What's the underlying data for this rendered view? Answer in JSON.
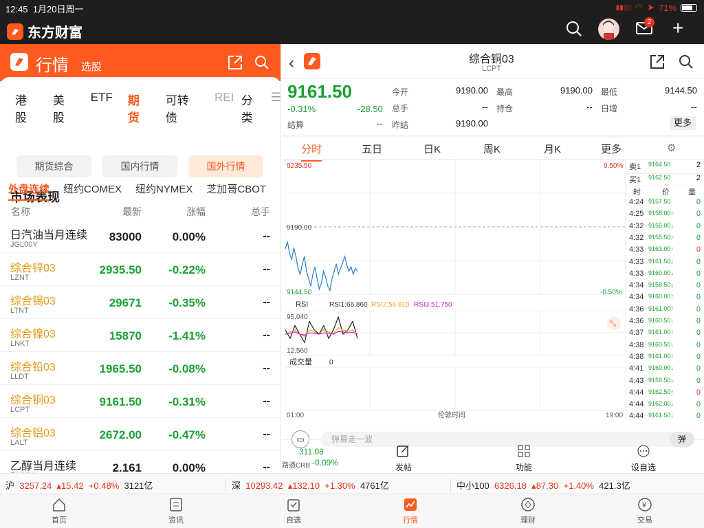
{
  "status": {
    "time": "12:45",
    "date": "1月20日周一",
    "battery": "71%"
  },
  "app": {
    "name": "东方财富",
    "badge": "2"
  },
  "left": {
    "title": "行情",
    "subtitle": "选股",
    "tabs": [
      "港股",
      "美股",
      "ETF",
      "期货",
      "可转债",
      "REI",
      "分类"
    ],
    "pills": [
      "期货综合",
      "国内行情",
      "国外行情"
    ],
    "section": "市场表现",
    "subtabs": [
      "外盘连续",
      "纽约COMEX",
      "纽约NYMEX",
      "芝加哥CBOT"
    ],
    "cols": {
      "name": "名称",
      "price": "最新",
      "change": "涨幅",
      "vol": "总手"
    },
    "rows": [
      {
        "name": "日汽油当月连续",
        "code": "JGL00Y",
        "price": "83000",
        "change": "0.00%",
        "vol": "--",
        "nc": "k",
        "pc": "k"
      },
      {
        "name": "综合锌03",
        "code": "LZNT",
        "price": "2935.50",
        "change": "-0.22%",
        "vol": "--",
        "nc": "o",
        "pc": "g"
      },
      {
        "name": "综合锡03",
        "code": "LTNT",
        "price": "29671",
        "change": "-0.35%",
        "vol": "--",
        "nc": "o",
        "pc": "g"
      },
      {
        "name": "综合镍03",
        "code": "LNKT",
        "price": "15870",
        "change": "-1.41%",
        "vol": "--",
        "nc": "o",
        "pc": "g"
      },
      {
        "name": "综合铅03",
        "code": "LLDT",
        "price": "1965.50",
        "change": "-0.08%",
        "vol": "--",
        "nc": "o",
        "pc": "g"
      },
      {
        "name": "综合铜03",
        "code": "LCPT",
        "price": "9161.50",
        "change": "-0.31%",
        "vol": "--",
        "nc": "o",
        "pc": "g"
      },
      {
        "name": "综合铝03",
        "code": "LALT",
        "price": "2672.00",
        "change": "-0.47%",
        "vol": "--",
        "nc": "o",
        "pc": "g"
      },
      {
        "name": "乙醇当月连续",
        "code": "EH00Y",
        "price": "2.161",
        "change": "0.00%",
        "vol": "--",
        "nc": "k",
        "pc": "k"
      }
    ]
  },
  "quote": {
    "title": "综合铜03",
    "code": "LCPT",
    "price": "9161.50",
    "pct": "-0.31%",
    "chg": "-28.50",
    "open_label": "今开",
    "open": "9190.00",
    "high_label": "最高",
    "high": "9190.00",
    "low_label": "最低",
    "low": "9144.50",
    "vol_label": "总手",
    "vol": "--",
    "oi_label": "持仓",
    "oi": "--",
    "daily_label": "日增",
    "daily": "--",
    "settle_label": "结算",
    "settle": "--",
    "prev_label": "昨结",
    "prev": "9190.00",
    "more": "更多"
  },
  "tabs": [
    "分时",
    "五日",
    "日K",
    "周K",
    "月K",
    "更多"
  ],
  "chart_labels": {
    "ymax": "9235.50",
    "ymid": "9190.00",
    "ymin": "9144.50",
    "pmax": "0.50%",
    "pmin": "-0.50%",
    "rsi": "RSI",
    "rsi1": "RSI1:66.860",
    "rsi2": "RSI2:56.810",
    "rsi3": "RSI3:51.750",
    "rsimax": "95.040",
    "rsimin": "12.560",
    "vol": "成交量",
    "vol0": "0",
    "tstart": "01:00",
    "tmid": "伦敦时间",
    "tend": "19:00"
  },
  "chart_data": {
    "type": "line",
    "title": "综合铜03",
    "xlabel": "伦敦时间",
    "ylim": [
      9144.5,
      9235.5
    ],
    "prev_close": 9190.0,
    "x_range": [
      "01:00",
      "19:00"
    ],
    "price": [
      9175,
      9180,
      9172,
      9168,
      9176,
      9170,
      9162,
      9158,
      9165,
      9170,
      9160,
      9155,
      9150,
      9158,
      9163,
      9155,
      9148,
      9152,
      9160,
      9156,
      9150,
      9147,
      9155,
      9160,
      9165,
      9158,
      9162,
      9166,
      9170,
      9164,
      9160,
      9163,
      9158,
      9162,
      9160
    ]
  },
  "book": {
    "ask": {
      "label": "卖1",
      "price": "9164.50",
      "qty": "2"
    },
    "bid": {
      "label": "买1",
      "price": "9162.50",
      "qty": "2"
    },
    "head": [
      "时",
      "价",
      "量"
    ],
    "ticks": [
      [
        "4:24",
        "9157.50",
        "",
        "0",
        "g"
      ],
      [
        "4:25",
        "9158.00",
        "↑",
        "0",
        "g"
      ],
      [
        "4:32",
        "9155.00",
        "↓",
        "0",
        "g"
      ],
      [
        "4:32",
        "9155.50",
        "↑",
        "0",
        "g"
      ],
      [
        "4:33",
        "9163.00",
        "↑",
        "0",
        "r"
      ],
      [
        "4:33",
        "9161.50",
        "↓",
        "0",
        "g"
      ],
      [
        "4:33",
        "9160.00",
        "↓",
        "0",
        "g"
      ],
      [
        "4:34",
        "9158.50",
        "↓",
        "0",
        "g"
      ],
      [
        "4:34",
        "9160.00",
        "↑",
        "0",
        "g"
      ],
      [
        "4:36",
        "9161.00",
        "↑",
        "0",
        "g"
      ],
      [
        "4:36",
        "9160.50",
        "↓",
        "0",
        "g"
      ],
      [
        "4:37",
        "9161.00",
        "↑",
        "0",
        "g"
      ],
      [
        "4:38",
        "9160.50",
        "↓",
        "0",
        "g"
      ],
      [
        "4:38",
        "9161.00",
        "↑",
        "0",
        "g"
      ],
      [
        "4:41",
        "9160.00",
        "↓",
        "0",
        "g"
      ],
      [
        "4:43",
        "9159.50",
        "↓",
        "0",
        "g"
      ],
      [
        "4:44",
        "9162.50",
        "↑",
        "0",
        "r"
      ],
      [
        "4:44",
        "9162.00",
        "↓",
        "0",
        "g"
      ],
      [
        "4:44",
        "9161.50",
        "↓",
        "0",
        "g"
      ]
    ]
  },
  "footer": {
    "price": "311.08",
    "label": "路透CRB",
    "pct": "-0.09%",
    "post": "发帖",
    "func": "功能",
    "watch": "设自选",
    "danmu": "弹幕走一波",
    "danmu_btn": "弹"
  },
  "indices": [
    {
      "name": "沪",
      "val": "3257.24",
      "chg": "15.42",
      "pct": "+0.48%",
      "amt": "3121亿"
    },
    {
      "name": "深",
      "val": "10293.42",
      "chg": "132.10",
      "pct": "+1.30%",
      "amt": "4761亿"
    },
    {
      "name": "中小100",
      "val": "6326.18",
      "chg": "87.30",
      "pct": "+1.40%",
      "amt": "421.3亿"
    }
  ],
  "nav": [
    "首页",
    "资讯",
    "自选",
    "行情",
    "理财",
    "交易"
  ]
}
